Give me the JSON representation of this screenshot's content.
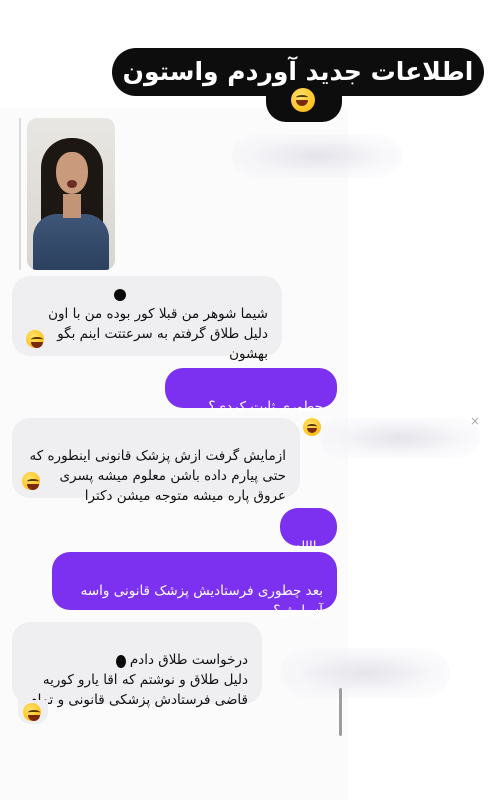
{
  "story": {
    "title": "اطلاعات جدید آوردم واستون",
    "title_emoji": "face-with-tears-of-joy"
  },
  "thread": {
    "reply_thumbnail": "story-reply-thumbnail"
  },
  "messages": [
    {
      "direction": "incoming",
      "text": "شیما شوهر من قبلا کور بوده من با اون\nدلیل طلاق گرفتم به سرعتتت اینم بگو\nبهشون",
      "emoji": "face-with-tears-of-joy"
    },
    {
      "direction": "outgoing",
      "text": "چطوری ثابت کردی؟",
      "emoji": "rolling-on-floor-laughing"
    },
    {
      "direction": "incoming",
      "text": "ازمایش گرفت ازش پزشک قانونی اینطوره که\nحتی پیارم داده باشن معلوم میشه پسری\nعروق پاره میشه متوجه میشن دکترا",
      "emoji": "face-with-tears-of-joy"
    },
    {
      "direction": "outgoing",
      "text": "واااای"
    },
    {
      "direction": "outgoing",
      "text": "بعد چطوری فرستادیش پزشک قانونی واسه\nآزمایش؟"
    },
    {
      "direction": "incoming",
      "text": "درخواست طلاق دادم\nدلیل طلاق و نوشتم که اقا یارو کوریه\nقاضی فرستادش پزشکی قانونی و تمام",
      "emoji": "face-with-tears-of-joy"
    }
  ],
  "colors": {
    "outgoing_bubble": "#7d31f0",
    "incoming_bubble": "#efeff1",
    "header_pill": "#0d0d0d"
  }
}
